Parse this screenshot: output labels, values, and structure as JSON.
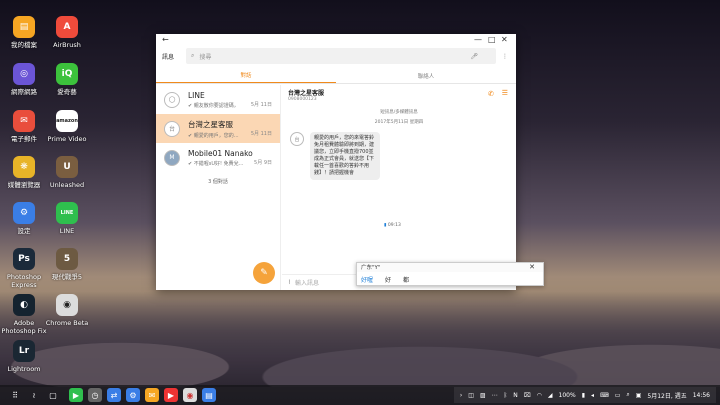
{
  "desktop": {
    "icons": [
      {
        "label": "我的檔案",
        "color": "#f6a623",
        "glyph": "▤"
      },
      {
        "label": "AirBrush",
        "color": "#ef4b3b",
        "glyph": "A"
      },
      {
        "label": "網際網路",
        "color": "#6b55d6",
        "glyph": "◎"
      },
      {
        "label": "愛奇藝",
        "color": "#3cc23c",
        "glyph": "iQ"
      },
      {
        "label": "電子郵件",
        "color": "#e94e3c",
        "glyph": "✉"
      },
      {
        "label": "Prime Video",
        "color": "#ffffff",
        "glyph": "amazon"
      },
      {
        "label": "媒體瀏覽器",
        "color": "#e8b428",
        "glyph": "❋"
      },
      {
        "label": "Unleashed",
        "color": "#7a5e40",
        "glyph": "U"
      },
      {
        "label": "設定",
        "color": "#3a7ee6",
        "glyph": "⚙"
      },
      {
        "label": "LINE",
        "color": "#2fbf4e",
        "glyph": "LINE"
      },
      {
        "label": "Photoshop Express",
        "color": "#1b2a3a",
        "glyph": "Ps"
      },
      {
        "label": "現代戰爭5",
        "color": "#6d5a42",
        "glyph": "5"
      },
      {
        "label": "Adobe Photoshop Fix",
        "color": "#15232f",
        "glyph": "◐"
      },
      {
        "label": "Chrome Beta",
        "color": "#dcdcdc",
        "glyph": "◉"
      },
      {
        "label": "Lightroom",
        "color": "#1a2733",
        "glyph": "Lr"
      }
    ]
  },
  "window": {
    "app_title": "訊息",
    "search_placeholder": "搜尋",
    "tabs": [
      "對話",
      "聯絡人"
    ],
    "conversations": [
      {
        "name": "LINE",
        "snippet": "✔ 親友散你要認證碼，",
        "date": "5月 11日",
        "avatar": ""
      },
      {
        "name": "台灣之星客服",
        "snippet": "✔ 親愛的用戶，您的...",
        "date": "5月 11日",
        "avatar": "台"
      },
      {
        "name": "Mobile01 Nanako",
        "snippet": "✔ 不錯喔sU好! 免費兌...",
        "date": "5月 9日",
        "avatar": "M"
      }
    ],
    "conversation_count": "3 個對話",
    "chat": {
      "title": "台灣之星客服",
      "number": "0908000123",
      "group_label": "短訊息/多媒體訊息",
      "date_label": "2017年5月11日 星期四",
      "avatar": "台",
      "message": "親愛的用戶，您的來電答鈴免月租費體驗即將到期，建議您，立即手機直撥700並成為正式會員，就送您【下載任一首喜歡的答鈴不用錢】！請把握機會",
      "time": "09:13",
      "input_placeholder": "輸入訊息"
    }
  },
  "ime": {
    "composition": "广东\"Y\"",
    "candidates": [
      "好喔",
      "好",
      "都"
    ]
  },
  "taskbar": {
    "battery": "100%",
    "date": "5月12日, 週五",
    "time": "14:56"
  }
}
